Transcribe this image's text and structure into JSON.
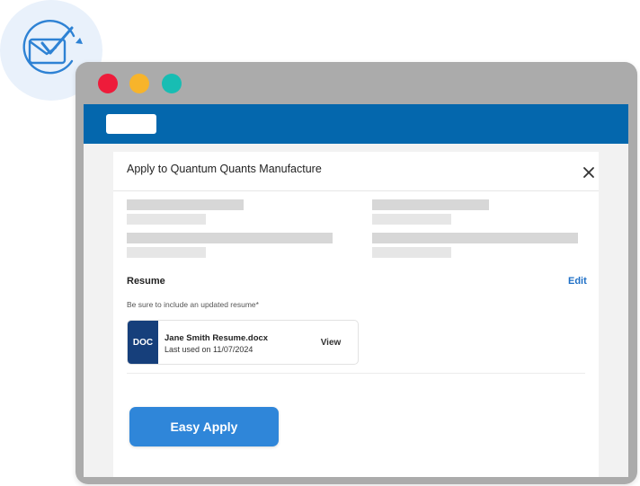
{
  "icons": {
    "badge": "envelope-check-icon",
    "close": "close-icon",
    "document": "doc-file-icon"
  },
  "colors": {
    "app_bar": "#0467ad",
    "accent": "#2f86d9",
    "link": "#1e6fc6",
    "doc_tile": "#163f7b",
    "window_dot_red": "#ee1b3a",
    "window_dot_yellow": "#f7b42b",
    "window_dot_teal": "#18bdb3"
  },
  "modal": {
    "title": "Apply to Quantum Quants Manufacture"
  },
  "resume": {
    "label": "Resume",
    "edit_label": "Edit",
    "hint": "Be sure to include an updated resume*",
    "file": {
      "type_label": "DOC",
      "name": "Jane Smith Resume.docx",
      "last_used": "Last used on 11/07/2024",
      "view_label": "View"
    }
  },
  "actions": {
    "easy_apply_label": "Easy Apply"
  }
}
